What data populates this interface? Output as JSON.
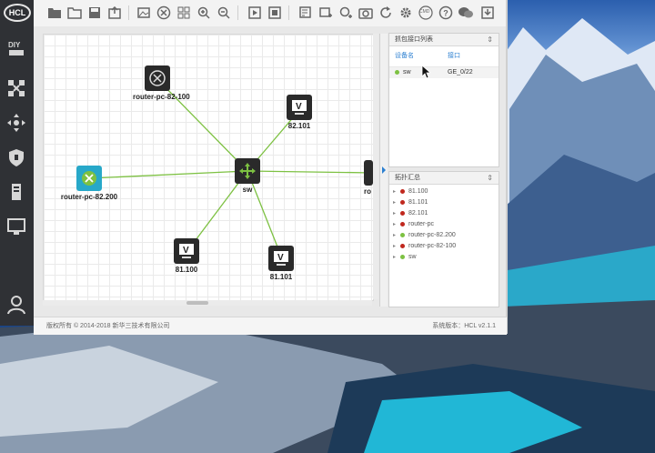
{
  "app": {
    "logo_text": "HCL"
  },
  "sidebar": {
    "items": [
      "diy-icon",
      "topology-icon",
      "move-icon",
      "shield-icon",
      "server-icon",
      "network-port-icon",
      "user-icon"
    ]
  },
  "toolbar": {
    "icons": [
      "new-folder-icon",
      "open-folder-icon",
      "save-icon",
      "export-icon",
      "image-icon",
      "fit-view-icon",
      "grid-icon",
      "zoom-in-icon",
      "zoom-out-icon",
      "play-icon",
      "stop-icon",
      "add-note-icon",
      "add-rect-icon",
      "add-circle-icon",
      "snapshot-icon",
      "refresh-icon",
      "settings-icon",
      "cmd-icon",
      "help-icon",
      "chat-icon",
      "download-icon"
    ],
    "cmd_label": "CMD"
  },
  "topology": {
    "nodes": [
      {
        "id": "router-pc-82-100",
        "label": "router-pc-82-100",
        "type": "router"
      },
      {
        "id": "82.101",
        "label": "82.101",
        "type": "pc"
      },
      {
        "id": "router-pc-82.200",
        "label": "router-pc-82.200",
        "type": "router-blue"
      },
      {
        "id": "sw",
        "label": "sw",
        "type": "switch"
      },
      {
        "id": "81.100",
        "label": "81.100",
        "type": "pc"
      },
      {
        "id": "81.101",
        "label": "81.101",
        "type": "pc"
      },
      {
        "id": "router-pc",
        "label": "ro",
        "type": "router"
      }
    ],
    "link_color": "#7dc142"
  },
  "interface_panel": {
    "title": "抓包接口列表",
    "columns": [
      "设备名",
      "接口"
    ],
    "rows": [
      {
        "device": "sw",
        "interface": "GE_0/22",
        "status_color": "#7dc142"
      }
    ]
  },
  "summary_panel": {
    "title": "拓扑汇总",
    "items": [
      {
        "label": "81.100",
        "color": "#c0281e"
      },
      {
        "label": "81.101",
        "color": "#c0281e"
      },
      {
        "label": "82.101",
        "color": "#c0281e"
      },
      {
        "label": "router-pc",
        "color": "#c0281e"
      },
      {
        "label": "router-pc-82.200",
        "color": "#7dc142"
      },
      {
        "label": "router-pc-82-100",
        "color": "#c0281e"
      },
      {
        "label": "sw",
        "color": "#7dc142"
      }
    ]
  },
  "status_bar": {
    "copyright": "版权所有 © 2014-2018 新华三技术有限公司",
    "version": "系统版本：HCL v2.1.1"
  }
}
